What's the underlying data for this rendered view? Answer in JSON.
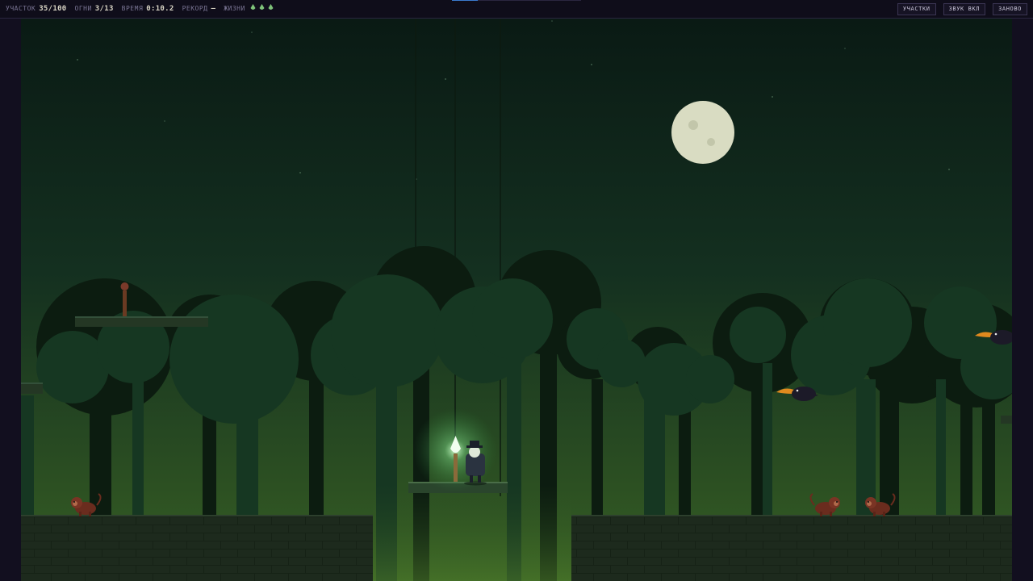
{
  "hud": {
    "section_label": "УЧАСТОК",
    "section_value": "35/100",
    "fires_label": "ОГНИ",
    "fires_value": "3/13",
    "time_label": "ВРЕМЯ",
    "time_value": "0:10.2",
    "record_label": "РЕКОРД",
    "record_value": "—",
    "lives_label": "ЖИЗНИ",
    "lives_count": 3,
    "progress": 0.2
  },
  "buttons": {
    "sections": "УЧАСТКИ",
    "sound": "ЗВУК ВКЛ",
    "restart": "ЗАНОВО"
  },
  "colors": {
    "sky_top": "#0a1a14",
    "sky_bottom": "#2f5a24",
    "moon": "#d9dcc2",
    "frame": "#120f1f",
    "accent": "#3b7bd0",
    "flame": "#e8ffe0",
    "life": "#7fc37a"
  },
  "icons": {
    "life": "flame-drop-icon",
    "player": "hat-wanderer-icon",
    "enemy_monkey": "monkey-icon",
    "enemy_bird": "toucan-icon"
  }
}
